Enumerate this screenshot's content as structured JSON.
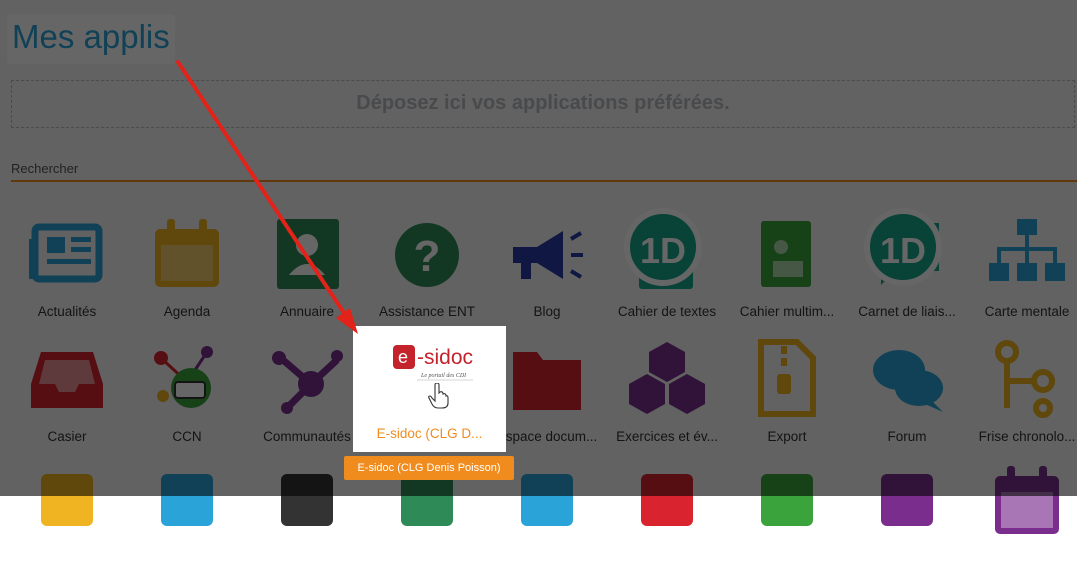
{
  "page": {
    "title": "Mes applis"
  },
  "dropzone": {
    "text": "Déposez ici vos applications préférées."
  },
  "search": {
    "placeholder": "Rechercher"
  },
  "apps": {
    "row1": [
      {
        "label": "Actualités",
        "icon": "newspaper-icon",
        "color": "#2aa3d8"
      },
      {
        "label": "Agenda",
        "icon": "calendar-icon",
        "color": "#f0b322"
      },
      {
        "label": "Annuaire",
        "icon": "contact-book-icon",
        "color": "#2e8b57"
      },
      {
        "label": "Assistance ENT",
        "icon": "help-circle-icon",
        "color": "#2e8b57"
      },
      {
        "label": "Blog",
        "icon": "megaphone-icon",
        "color": "#2b3aa8"
      },
      {
        "label": "Cahier de textes",
        "icon": "notebook-icon",
        "color": "#17a589",
        "badge": "1D"
      },
      {
        "label": "Cahier multim...",
        "icon": "multimedia-notebook-icon",
        "color": "#3ba33b"
      },
      {
        "label": "Carnet de liais...",
        "icon": "chat-note-icon",
        "color": "#17a589",
        "badge": "1D"
      },
      {
        "label": "Carte mentale",
        "icon": "org-chart-icon",
        "color": "#2aa3d8"
      }
    ],
    "row2": [
      {
        "label": "Casier",
        "icon": "inbox-tray-icon",
        "color": "#d9232e"
      },
      {
        "label": "CCN",
        "icon": "ccn-network-icon",
        "color": "#3ba33b"
      },
      {
        "label": "Communautés",
        "icon": "share-nodes-icon",
        "color": "#7b2d8e"
      },
      {
        "label": "E-sidoc (CLG D...",
        "icon": "esidoc-logo",
        "color": "#c4232b"
      },
      {
        "label": "Espace docum...",
        "icon": "folder-icon",
        "color": "#d9232e"
      },
      {
        "label": "Exercices et év...",
        "icon": "cubes-icon",
        "color": "#7b2d8e"
      },
      {
        "label": "Export",
        "icon": "zip-file-icon",
        "color": "#f0b322"
      },
      {
        "label": "Forum",
        "icon": "chat-bubbles-icon",
        "color": "#2aa3d8"
      },
      {
        "label": "Frise chronolo...",
        "icon": "timeline-icon",
        "color": "#f0b322"
      }
    ],
    "row3_icons": [
      "mail-icon",
      "image-icon",
      "graduation-icon",
      "group-icon",
      "tools-icon",
      "frame-icon",
      "music-notebook-icon",
      "cart-icon",
      "calendar-icon"
    ]
  },
  "badge_text": "1D",
  "esidoc": {
    "logo_prefix": "e",
    "logo_text": "-sidoc",
    "logo_tagline": "Le portail des CDI",
    "tooltip": "E-sidoc (CLG Denis Poisson)"
  }
}
